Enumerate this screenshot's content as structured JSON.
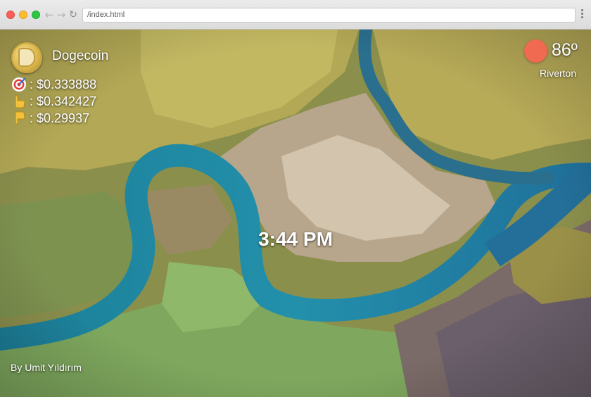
{
  "browser": {
    "url": "/index.html"
  },
  "coin": {
    "name": "Dogecoin",
    "icon": "dogecoin-logo-icon"
  },
  "prices": [
    {
      "icon": "target-icon",
      "label": ": $0.333888"
    },
    {
      "icon": "thumbs-up-icon",
      "label": ": $0.342427"
    },
    {
      "icon": "thumbs-down-icon",
      "label": ": $0.29937"
    }
  ],
  "clock": {
    "time": "3:44 PM"
  },
  "weather": {
    "icon": "sun-icon",
    "temperature": "86º",
    "city": "Riverton"
  },
  "credit": {
    "text": "By  Umit Yıldırım"
  },
  "colors": {
    "river": "#1f8aa6",
    "sun": "#ef6a50"
  }
}
